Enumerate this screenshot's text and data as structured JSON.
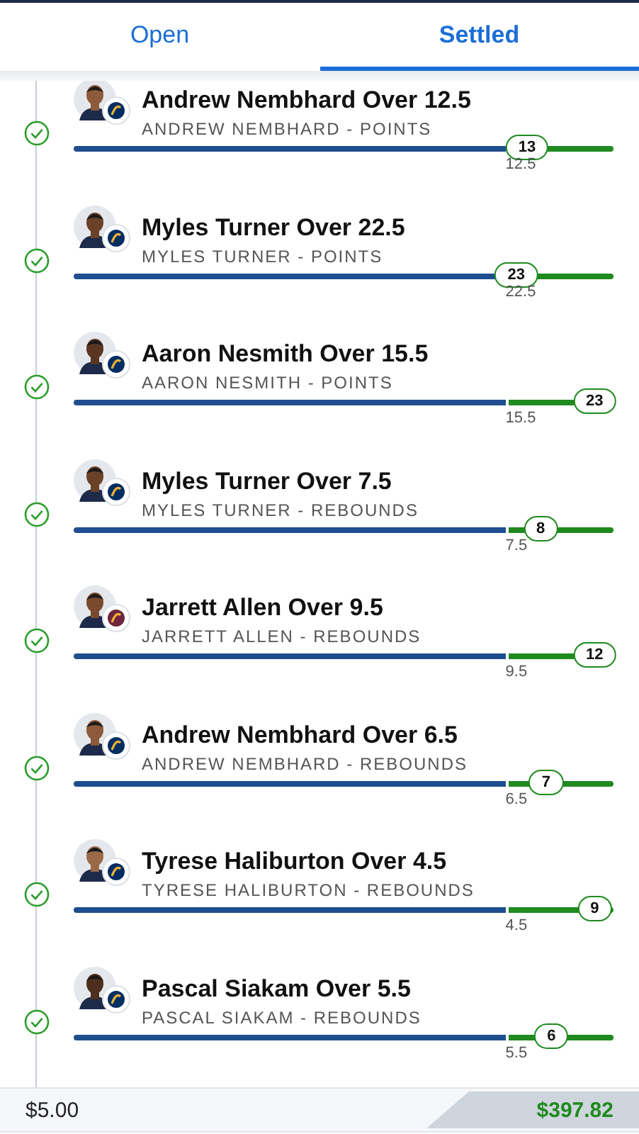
{
  "tabs": [
    {
      "label": "Open",
      "selected": false
    },
    {
      "label": "Settled",
      "selected": true
    }
  ],
  "bets": [
    {
      "title": "Andrew Nembhard Over 12.5",
      "subtitle": "ANDREW NEMBHARD - POINTS",
      "result": "13",
      "line": "12.5",
      "level": 0.84,
      "color": "#002d62"
    },
    {
      "title": "Myles Turner Over 22.5",
      "subtitle": "MYLES TURNER - POINTS",
      "result": "23",
      "line": "22.5",
      "level": 0.82,
      "color": "#002d62"
    },
    {
      "title": "Aaron Nesmith Over 15.5",
      "subtitle": "AARON NESMITH - POINTS",
      "result": "23",
      "line": "15.5",
      "level": 0.965,
      "color": "#002d62"
    },
    {
      "title": "Myles Turner Over 7.5",
      "subtitle": "MYLES TURNER - REBOUNDS",
      "result": "8",
      "line": "7.5",
      "level": 0.865,
      "color": "#002d62"
    },
    {
      "title": "Jarrett Allen Over 9.5",
      "subtitle": "JARRETT ALLEN - REBOUNDS",
      "result": "12",
      "line": "9.5",
      "level": 0.965,
      "color": "#6f263d"
    },
    {
      "title": "Andrew Nembhard Over 6.5",
      "subtitle": "ANDREW NEMBHARD - REBOUNDS",
      "result": "7",
      "line": "6.5",
      "level": 0.875,
      "color": "#002d62"
    },
    {
      "title": "Tyrese Haliburton Over 4.5",
      "subtitle": "TYRESE HALIBURTON - REBOUNDS",
      "result": "9",
      "line": "4.5",
      "level": 0.965,
      "color": "#002d62"
    },
    {
      "title": "Pascal Siakam Over 5.5",
      "subtitle": "PASCAL SIAKAM - REBOUNDS",
      "result": "6",
      "line": "5.5",
      "level": 0.885,
      "color": "#002d62"
    }
  ],
  "footer": {
    "stake": "$5.00",
    "payout": "$397.82"
  }
}
